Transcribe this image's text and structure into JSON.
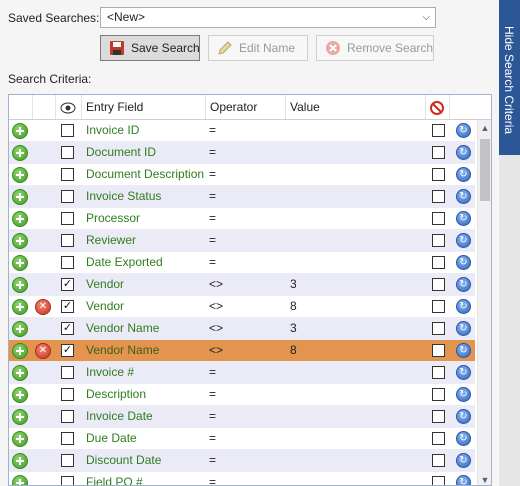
{
  "saved_searches": {
    "label": "Saved Searches:",
    "selected": "<New>"
  },
  "buttons": {
    "save": "Save Search",
    "edit": "Edit Name",
    "remove": "Remove Search"
  },
  "criteria_label": "Search Criteria:",
  "columns": {
    "entry_field": "Entry Field",
    "operator": "Operator",
    "value": "Value"
  },
  "side_tab": "Hide Search Criteria",
  "colors": {
    "field_text": "#2f7d1e",
    "selected_row": "#e3944e",
    "side_tab": "#2b5797"
  },
  "rows": [
    {
      "field": "Invoice ID",
      "operator": "=",
      "value": "",
      "visible": false,
      "removable": false,
      "selected": false
    },
    {
      "field": "Document ID",
      "operator": "=",
      "value": "",
      "visible": false,
      "removable": false,
      "selected": false
    },
    {
      "field": "Document Description",
      "operator": "=",
      "value": "",
      "visible": false,
      "removable": false,
      "selected": false
    },
    {
      "field": "Invoice Status",
      "operator": "=",
      "value": "",
      "visible": false,
      "removable": false,
      "selected": false
    },
    {
      "field": "Processor",
      "operator": "=",
      "value": "",
      "visible": false,
      "removable": false,
      "selected": false
    },
    {
      "field": "Reviewer",
      "operator": "=",
      "value": "",
      "visible": false,
      "removable": false,
      "selected": false
    },
    {
      "field": "Date Exported",
      "operator": "=",
      "value": "",
      "visible": false,
      "removable": false,
      "selected": false
    },
    {
      "field": "Vendor",
      "operator": "<>",
      "value": "3",
      "visible": true,
      "removable": false,
      "selected": false
    },
    {
      "field": "Vendor",
      "operator": "<>",
      "value": "8",
      "visible": true,
      "removable": true,
      "selected": false
    },
    {
      "field": "Vendor Name",
      "operator": "<>",
      "value": "3",
      "visible": true,
      "removable": false,
      "selected": false
    },
    {
      "field": "Vendor Name",
      "operator": "<>",
      "value": "8",
      "visible": true,
      "removable": true,
      "selected": true
    },
    {
      "field": "Invoice #",
      "operator": "=",
      "value": "",
      "visible": false,
      "removable": false,
      "selected": false
    },
    {
      "field": "Description",
      "operator": "=",
      "value": "",
      "visible": false,
      "removable": false,
      "selected": false
    },
    {
      "field": "Invoice Date",
      "operator": "=",
      "value": "",
      "visible": false,
      "removable": false,
      "selected": false
    },
    {
      "field": "Due Date",
      "operator": "=",
      "value": "",
      "visible": false,
      "removable": false,
      "selected": false
    },
    {
      "field": "Discount Date",
      "operator": "=",
      "value": "",
      "visible": false,
      "removable": false,
      "selected": false
    },
    {
      "field": "Field PO #",
      "operator": "=",
      "value": "",
      "visible": false,
      "removable": false,
      "selected": false
    }
  ]
}
